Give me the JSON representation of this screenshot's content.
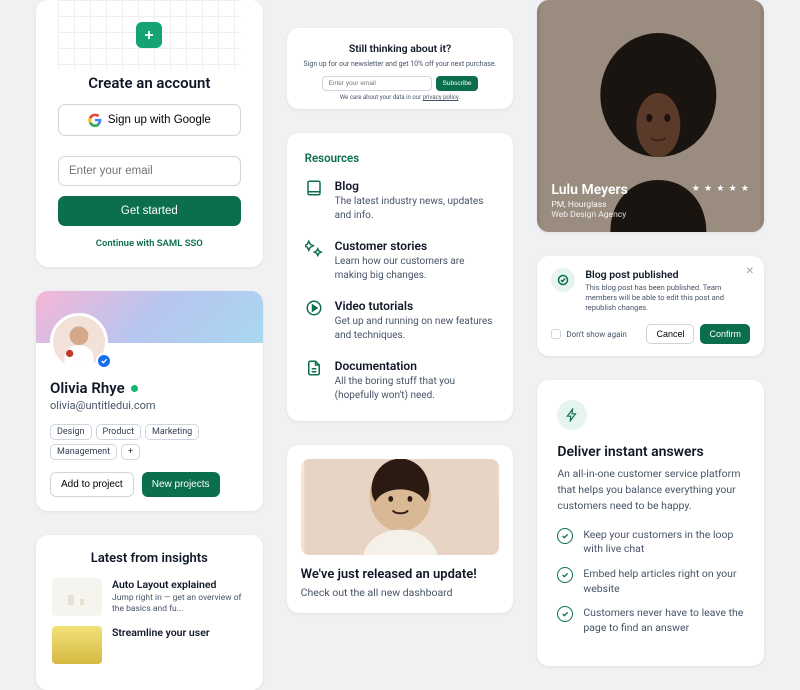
{
  "signup": {
    "title": "Create an account",
    "google": "Sign up with Google",
    "email_placeholder": "Enter your email",
    "cta": "Get started",
    "saml": "Continue with SAML SSO"
  },
  "profile": {
    "name": "Olivia Rhye",
    "email": "olivia@untitledui.com",
    "tags": [
      "Design",
      "Product",
      "Marketing",
      "Management",
      "+"
    ],
    "add_to_project": "Add to project",
    "new_projects": "New projects"
  },
  "insights": {
    "title": "Latest from insights",
    "items": [
      {
        "title": "Auto Layout explained",
        "desc": "Jump right in — get an overview of the basics and fu..."
      },
      {
        "title": "Streamline your user",
        "desc": ""
      }
    ]
  },
  "newsletter": {
    "title": "Still thinking about it?",
    "sub": "Sign up for our newsletter and get 10% off your next purchase.",
    "placeholder": "Enter your email",
    "cta": "Subscribe",
    "note_prefix": "We care about your data in our ",
    "note_link": "privacy policy"
  },
  "resources": {
    "title": "Resources",
    "items": [
      {
        "icon": "book",
        "label": "Blog",
        "desc": "The latest industry news, updates and info."
      },
      {
        "icon": "stars",
        "label": "Customer stories",
        "desc": "Learn how our customers are making big changes."
      },
      {
        "icon": "play",
        "label": "Video tutorials",
        "desc": "Get up and running on new features and techniques."
      },
      {
        "icon": "file",
        "label": "Documentation",
        "desc": "All the boring stuff that you (hopefully won't) need."
      }
    ]
  },
  "update": {
    "title": "We've just released an update!",
    "desc": "Check out the all new dashboard"
  },
  "testimonial": {
    "name": "Lulu Meyers",
    "role": "PM, Hourglass",
    "company": "Web Design Agency",
    "stars": "★ ★ ★ ★ ★"
  },
  "modal": {
    "title": "Blog post published",
    "desc": "This blog post has been published. Team members will be able to edit this post and republish changes.",
    "dont_show": "Don't show again",
    "cancel": "Cancel",
    "confirm": "Confirm"
  },
  "answers": {
    "title": "Deliver instant answers",
    "desc": "An all-in-one customer service platform that helps you balance everything your customers need to be happy.",
    "items": [
      "Keep your customers in the loop with live chat",
      "Embed help articles right on your website",
      "Customers never have to leave the page to find an answer"
    ]
  }
}
